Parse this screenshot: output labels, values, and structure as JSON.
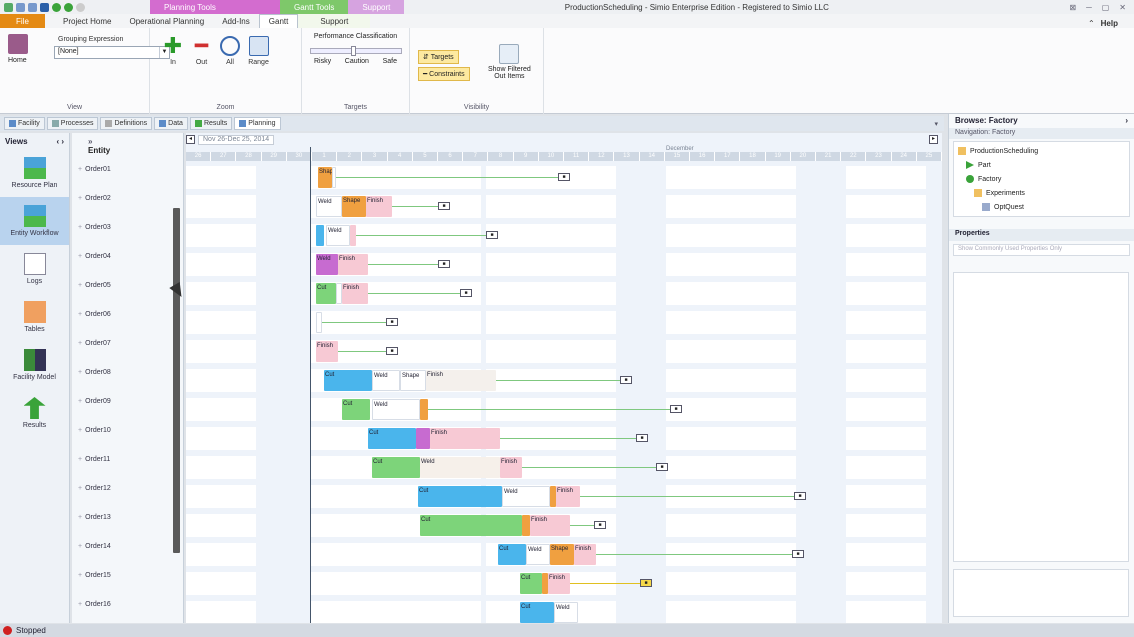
{
  "app": {
    "title": "ProductionScheduling - Simio Enterprise Edition - Registered to Simio LLC",
    "context_tabs": [
      "Planning Tools",
      "Gantt Tools",
      "Support"
    ],
    "file_tab": "File",
    "ribbon_tabs": [
      "Project Home",
      "Operational Planning",
      "Add-Ins",
      "Gantt",
      "Support"
    ],
    "active_tab": "Gantt",
    "help": "Help"
  },
  "ribbon": {
    "view_group": {
      "label": "View",
      "home_label": "Home",
      "grouping_label": "Grouping Expression",
      "grouping_value": "[None]"
    },
    "zoom_group": {
      "label": "Zoom",
      "buttons": [
        "In",
        "Out",
        "All",
        "Range"
      ]
    },
    "targets_group": {
      "label": "Targets",
      "title": "Performance Classification",
      "options": [
        "Risky",
        "Caution",
        "Safe"
      ]
    },
    "visibility_group": {
      "label": "Visibility",
      "targets": "Targets",
      "constraints": "Constraints",
      "show_filtered_1": "Show Filtered",
      "show_filtered_2": "Out Items"
    }
  },
  "doc_tabs": [
    "Facility",
    "Processes",
    "Definitions",
    "Data",
    "Results",
    "Planning"
  ],
  "views": {
    "title": "Views",
    "items": [
      "Resource Plan",
      "Entity Workflow",
      "Logs",
      "Tables",
      "Facility Model",
      "Results"
    ],
    "active": "Entity Workflow"
  },
  "entity": {
    "header": "Entity",
    "rows": [
      "Order01",
      "Order02",
      "Order03",
      "Order04",
      "Order05",
      "Order06",
      "Order07",
      "Order08",
      "Order09",
      "Order10",
      "Order11",
      "Order12",
      "Order13",
      "Order14",
      "Order15",
      "Order16"
    ]
  },
  "gantt": {
    "date_range": "Nov 26-Dec 25, 2014",
    "month": "December",
    "day_labels": [
      "26",
      "27",
      "28",
      "29",
      "30",
      "1",
      "2",
      "3",
      "4",
      "5",
      "6",
      "7",
      "8",
      "9",
      "10",
      "11",
      "12",
      "13",
      "14",
      "15",
      "16",
      "17",
      "18",
      "19",
      "20",
      "21",
      "22",
      "23",
      "24",
      "25"
    ]
  },
  "browse": {
    "title": "Browse: Factory",
    "nav": "Navigation: Factory",
    "tree": [
      "ProductionScheduling",
      "Part",
      "Factory",
      "Experiments",
      "OptQuest"
    ],
    "properties": "Properties",
    "props_check": "Show Commonly Used Properties Only"
  },
  "status": {
    "text": "Stopped"
  },
  "colors": {
    "file_tab": "#e48a14",
    "gantt_tab": "#7ec86a",
    "planning_ctx": "#d36ccf",
    "cut": "#4ab5ec",
    "weld": "#7dd47a",
    "finish": "#f7c9d4",
    "shape": "#f0a040",
    "operator": "#c76bd0"
  }
}
